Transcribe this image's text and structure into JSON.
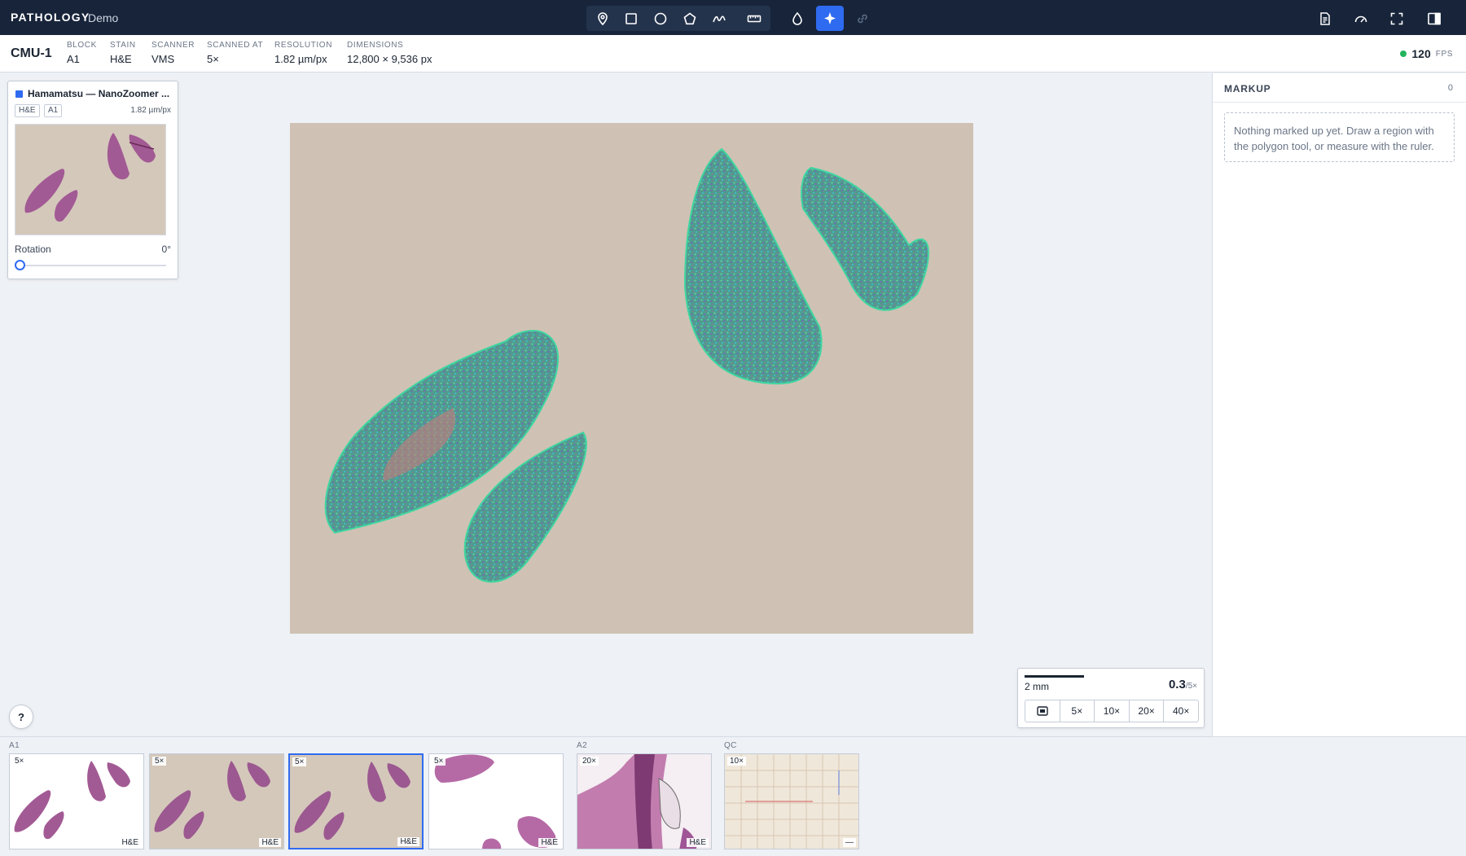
{
  "app": {
    "brand": "PATHOLOGY",
    "subtitle": "Demo"
  },
  "toolbar": {
    "tools": [
      "pin-icon",
      "rectangle-icon",
      "circle-icon",
      "polygon-icon",
      "freehand-icon",
      "ruler-icon"
    ],
    "tools2": [
      "droplet-icon",
      "sparkle-icon",
      "link-icon"
    ],
    "active_tool": "sparkle-icon",
    "right": [
      "report-icon",
      "gauge-icon",
      "fullscreen-icon",
      "panel-toggle-icon"
    ]
  },
  "slide": {
    "id": "CMU-1",
    "meta": [
      {
        "label": "BLOCK",
        "value": "A1"
      },
      {
        "label": "STAIN",
        "value": "H&E"
      },
      {
        "label": "SCANNER",
        "value": "VMS"
      },
      {
        "label": "SCANNED AT",
        "value": "5×"
      },
      {
        "label": "RESOLUTION",
        "value": "1.82 µm/px"
      },
      {
        "label": "DIMENSIONS",
        "value": "12,800 × 9,536 px"
      }
    ],
    "fps": "120",
    "fps_unit": "FPS"
  },
  "info_card": {
    "title": "Hamamatsu — NanoZoomer ...",
    "tags": [
      "H&E",
      "A1"
    ],
    "resolution": "1.82 µm/px",
    "rotation_label": "Rotation",
    "rotation_value": "0°",
    "rotation_fraction": 0
  },
  "help_label": "?",
  "zoom": {
    "scale_label": "2 mm",
    "magnification": "0.3",
    "mag_suffix": "/5×",
    "buttons": [
      "5×",
      "10×",
      "20×",
      "40×"
    ]
  },
  "markup": {
    "title": "MARKUP",
    "count": "0",
    "empty_text": "Nothing marked up yet. Draw a region with the polygon tool, or measure with the ruler."
  },
  "filmstrip": {
    "groups": [
      "A1",
      "A2",
      "QC"
    ],
    "thumbs": [
      {
        "mag": "5×",
        "stain": "H&E",
        "selected": false
      },
      {
        "mag": "5×",
        "stain": "H&E",
        "selected": false
      },
      {
        "mag": "5×",
        "stain": "H&E",
        "selected": true
      },
      {
        "mag": "5×",
        "stain": "H&E",
        "selected": false
      },
      {
        "mag": "20×",
        "stain": "H&E",
        "selected": false
      },
      {
        "mag": "10×",
        "stain": "—",
        "selected": false
      }
    ]
  },
  "colors": {
    "accent": "#2f6bf0",
    "topbar": "#17243a",
    "fps_dot": "#22b35e",
    "tissue": "#a8568f",
    "overlay": "#3fd6a0"
  }
}
